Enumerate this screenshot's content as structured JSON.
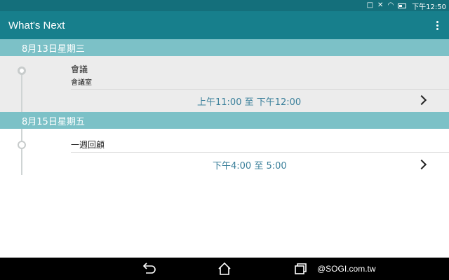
{
  "status_bar": {
    "time": "下午12:50",
    "icons": [
      "bluetooth-icon",
      "mute-icon",
      "wifi-icon",
      "battery-icon"
    ]
  },
  "app_bar": {
    "title": "What's Next",
    "menu_icon": "overflow-menu-icon"
  },
  "sections": [
    {
      "date": "8月13日星期三",
      "events": [
        {
          "title": "會議",
          "location": "會議室",
          "time": "上午11:00 至 下午12:00",
          "selected": true
        }
      ]
    },
    {
      "date": "8月15日星期五",
      "events": [
        {
          "title": "一週回顧",
          "location": "",
          "time": "下午4:00 至 5:00",
          "selected": false
        }
      ]
    }
  ],
  "nav_bar": {
    "buttons": [
      "back-icon",
      "home-icon",
      "recents-icon"
    ],
    "watermark": "@SOGI.com.tw"
  },
  "colors": {
    "status_bar": "#146f7b",
    "app_bar": "#177f8c",
    "date_header": "#7cc1c7",
    "time_text": "#3a7f9a",
    "selected_row": "#ececec"
  }
}
